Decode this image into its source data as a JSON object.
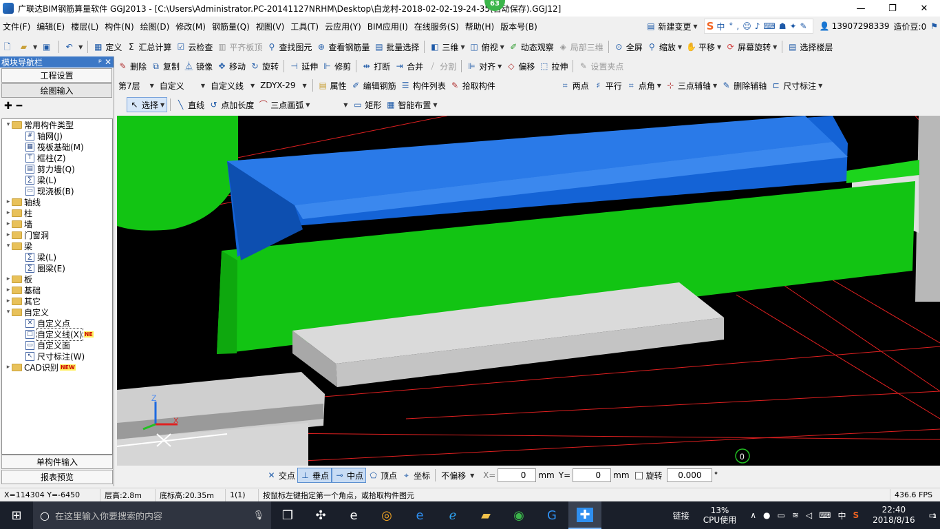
{
  "window": {
    "title": "广联达BIM钢筋算量软件 GGJ2013 - [C:\\Users\\Administrator.PC-20141127NRHM\\Desktop\\白龙村-2018-02-02-19-24-35(自动保存).GGJ12]",
    "badge": "63",
    "minimize": "—",
    "restore": "❐",
    "close": "✕"
  },
  "menu": [
    "文件(F)",
    "编辑(E)",
    "楼层(L)",
    "构件(N)",
    "绘图(D)",
    "修改(M)",
    "钢筋量(Q)",
    "视图(V)",
    "工具(T)",
    "云应用(Y)",
    "BIM应用(I)",
    "在线服务(S)",
    "帮助(H)",
    "版本号(B)"
  ],
  "menu_right": {
    "new_change": "新建变更",
    "ime_label": "中",
    "phone": "13907298339",
    "price_bean": "造价豆:0"
  },
  "toolbar1": {
    "define": "定义",
    "sum": "汇总计算",
    "cloud_check": "云检查",
    "flat_top": "平齐板顶",
    "find": "查找图元",
    "view_rebar": "查看钢筋量",
    "batch_select": "批量选择",
    "three_d": "三维",
    "top_view": "俯视",
    "dynamic_view": "动态观察",
    "local_3d": "局部三维",
    "fullscreen": "全屏",
    "zoom": "缩放",
    "pan": "平移",
    "rotate_screen": "屏幕旋转",
    "select_floor": "选择楼层"
  },
  "toolbar2": {
    "delete": "删除",
    "copy": "复制",
    "mirror": "镜像",
    "move": "移动",
    "rotate": "旋转",
    "extend": "延伸",
    "trim": "修剪",
    "break": "打断",
    "merge": "合并",
    "split": "分割",
    "align": "对齐",
    "offset": "偏移",
    "stretch": "拉伸",
    "set_grip": "设置夹点"
  },
  "toolbar3": {
    "floor": "第7层",
    "category": "自定义",
    "type": "自定义线",
    "element": "ZDYX-29",
    "properties": "属性",
    "edit_rebar": "编辑钢筋",
    "element_list": "构件列表",
    "pick": "拾取构件",
    "two_point": "两点",
    "parallel": "平行",
    "point_angle": "点角",
    "three_point_axis": "三点辅轴",
    "delete_axis": "删除辅轴",
    "dimension": "尺寸标注"
  },
  "toolbar4": {
    "select": "选择",
    "line": "直线",
    "point_length": "点加长度",
    "three_point_arc": "三点画弧",
    "rect": "矩形",
    "smart_layout": "智能布置"
  },
  "left_panel": {
    "title": "模块导航栏",
    "pin": "ᵖ ✕",
    "btn_settings": "工程设置",
    "btn_drawing": "绘图输入",
    "tree": [
      {
        "indent": 0,
        "tw": "▾",
        "kind": "folder",
        "label": "常用构件类型"
      },
      {
        "indent": 1,
        "tw": "",
        "kind": "comp",
        "glyph": "#",
        "label": "轴网(J)"
      },
      {
        "indent": 1,
        "tw": "",
        "kind": "comp",
        "glyph": "▦",
        "label": "筏板基础(M)"
      },
      {
        "indent": 1,
        "tw": "",
        "kind": "comp",
        "glyph": "T",
        "label": "框柱(Z)"
      },
      {
        "indent": 1,
        "tw": "",
        "kind": "comp",
        "glyph": "▤",
        "label": "剪力墙(Q)"
      },
      {
        "indent": 1,
        "tw": "",
        "kind": "comp",
        "glyph": "∑",
        "label": "梁(L)"
      },
      {
        "indent": 1,
        "tw": "",
        "kind": "comp",
        "glyph": "▭",
        "label": "现浇板(B)"
      },
      {
        "indent": 0,
        "tw": "▸",
        "kind": "folder",
        "label": "轴线"
      },
      {
        "indent": 0,
        "tw": "▸",
        "kind": "folder",
        "label": "柱"
      },
      {
        "indent": 0,
        "tw": "▸",
        "kind": "folder",
        "label": "墙"
      },
      {
        "indent": 0,
        "tw": "▸",
        "kind": "folder",
        "label": "门窗洞"
      },
      {
        "indent": 0,
        "tw": "▾",
        "kind": "folder",
        "label": "梁"
      },
      {
        "indent": 1,
        "tw": "",
        "kind": "comp",
        "glyph": "∑",
        "label": "梁(L)"
      },
      {
        "indent": 1,
        "tw": "",
        "kind": "comp",
        "glyph": "∑",
        "label": "圈梁(E)"
      },
      {
        "indent": 0,
        "tw": "▸",
        "kind": "folder",
        "label": "板"
      },
      {
        "indent": 0,
        "tw": "▸",
        "kind": "folder",
        "label": "基础"
      },
      {
        "indent": 0,
        "tw": "▸",
        "kind": "folder",
        "label": "其它"
      },
      {
        "indent": 0,
        "tw": "▾",
        "kind": "folder",
        "label": "自定义"
      },
      {
        "indent": 1,
        "tw": "",
        "kind": "comp",
        "glyph": "✕",
        "label": "自定义点"
      },
      {
        "indent": 1,
        "tw": "",
        "kind": "comp",
        "glyph": "□",
        "label": "自定义线(X)",
        "tag": "NE",
        "selected": true
      },
      {
        "indent": 1,
        "tw": "",
        "kind": "comp",
        "glyph": "▭",
        "label": "自定义面"
      },
      {
        "indent": 1,
        "tw": "",
        "kind": "comp",
        "glyph": "↖",
        "label": "尺寸标注(W)"
      },
      {
        "indent": 0,
        "tw": "▸",
        "kind": "folder",
        "label": "CAD识别",
        "tag": "NEW"
      }
    ],
    "btn_single": "单构件输入",
    "btn_report": "报表预览"
  },
  "snap": {
    "intersection": "交点",
    "perpendicular": "垂点",
    "midpoint": "中点",
    "vertex": "顶点",
    "coordinate": "坐标",
    "offset_mode": "不偏移",
    "x_label": "X=",
    "x_value": "0",
    "y_label": "Y=",
    "y_value": "0",
    "unit": "mm",
    "rotate_label": "旋转",
    "rotate_value": "0.000",
    "degree": "°"
  },
  "status": {
    "coords": "X=114304  Y=-6450",
    "floor_height": "层高:2.8m",
    "base_height": "底标高:20.35m",
    "count": "1(1)",
    "hint": "按鼠标左键指定第一个角点，或拾取构件图元",
    "fps": "436.6 FPS"
  },
  "taskbar": {
    "search_placeholder": "在这里输入你要搜索的内容",
    "network": "链接",
    "cpu": "13%",
    "cpu_label": "CPU使用",
    "ime": "中",
    "time": "22:40",
    "date": "2018/8/16",
    "notif": "1"
  },
  "viewport": {
    "axis_z": "Z",
    "axis_x": "X",
    "marker": "0"
  },
  "colors": {
    "panel_head": "#3c78c6",
    "beam_blue": "#1463d6",
    "beam_green": "#12c413",
    "slab_grey": "#d8d8d8"
  }
}
